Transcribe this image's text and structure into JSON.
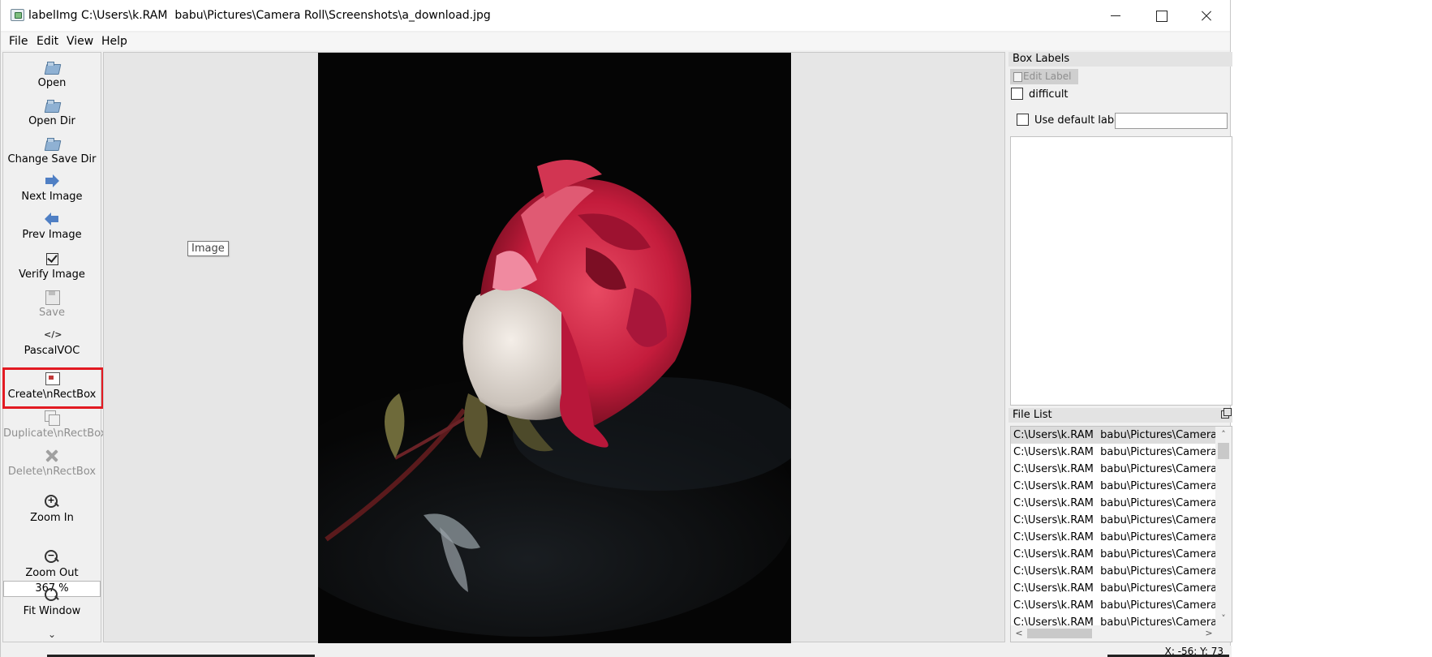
{
  "window": {
    "title": "labelImg C:\\Users\\k.RAM  babu\\Pictures\\Camera Roll\\Screenshots\\a_download.jpg",
    "minimize": "minimize",
    "maximize": "maximize",
    "close": "close"
  },
  "menu": [
    "File",
    "Edit",
    "View",
    "Help"
  ],
  "toolbar": {
    "open": "Open",
    "open_dir": "Open Dir",
    "change_save_dir": "Change Save Dir",
    "next_image": "Next Image",
    "prev_image": "Prev Image",
    "verify_image": "Verify Image",
    "save": "Save",
    "format": "PascalVOC",
    "format_icon": "</>",
    "create_rect": "Create\\nRectBox",
    "duplicate_rect": "Duplicate\\nRectBox",
    "delete_rect": "Delete\\nRectBox",
    "zoom_in": "Zoom In",
    "zoom_value": "367 %",
    "zoom_out": "Zoom Out",
    "fit_window": "Fit Window",
    "more": "»"
  },
  "canvas": {
    "tooltip": "Image"
  },
  "box_labels": {
    "title": "Box Labels",
    "edit_label": "Edit Label",
    "difficult": "difficult",
    "use_default_label": "Use default label",
    "default_label_value": ""
  },
  "file_list": {
    "title": "File List",
    "items": [
      "C:\\Users\\k.RAM  babu\\Pictures\\Camera",
      "C:\\Users\\k.RAM  babu\\Pictures\\Camera",
      "C:\\Users\\k.RAM  babu\\Pictures\\Camera",
      "C:\\Users\\k.RAM  babu\\Pictures\\Camera",
      "C:\\Users\\k.RAM  babu\\Pictures\\Camera",
      "C:\\Users\\k.RAM  babu\\Pictures\\Camera",
      "C:\\Users\\k.RAM  babu\\Pictures\\Camera",
      "C:\\Users\\k.RAM  babu\\Pictures\\Camera",
      "C:\\Users\\k.RAM  babu\\Pictures\\Camera",
      "C:\\Users\\k.RAM  babu\\Pictures\\Camera",
      "C:\\Users\\k.RAM  babu\\Pictures\\Camera",
      "C:\\Users\\k.RAM  babu\\Pictures\\Camera"
    ]
  },
  "status": {
    "coords": "X: -56; Y: 73"
  },
  "colors": {
    "highlight": "#e21a22",
    "arrow_blue": "#4f7fc4",
    "rose_red": "#d0243f"
  }
}
